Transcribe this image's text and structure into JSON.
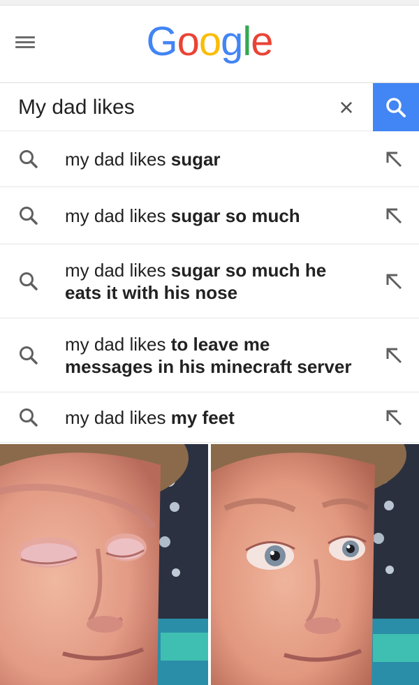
{
  "header": {
    "menu_icon": "hamburger-menu-icon",
    "logo_text": "Google",
    "logo_letters": [
      {
        "char": "G",
        "color": "#4285f4"
      },
      {
        "char": "o",
        "color": "#ea4335"
      },
      {
        "char": "o",
        "color": "#fbbc05"
      },
      {
        "char": "g",
        "color": "#4285f4"
      },
      {
        "char": "l",
        "color": "#34a853"
      },
      {
        "char": "e",
        "color": "#ea4335"
      }
    ]
  },
  "search": {
    "value": "My dad likes",
    "clear_icon": "close-icon",
    "clear_glyph": "×",
    "submit_icon": "search-icon",
    "accent_color": "#4285f4"
  },
  "suggestions": [
    {
      "prefix": "my dad likes ",
      "bold_lines": [
        "sugar"
      ],
      "icon": "search-icon",
      "fill_icon": "arrow-up-left-icon"
    },
    {
      "prefix": "my dad likes ",
      "bold_lines": [
        "sugar so much"
      ],
      "icon": "search-icon",
      "fill_icon": "arrow-up-left-icon"
    },
    {
      "prefix": "my dad likes ",
      "bold_lines": [
        "sugar so much he",
        "eats it with his nose"
      ],
      "icon": "search-icon",
      "fill_icon": "arrow-up-left-icon"
    },
    {
      "prefix": "my dad likes ",
      "bold_lines": [
        "to leave me",
        "messages in his minecraft server"
      ],
      "icon": "search-icon",
      "fill_icon": "arrow-up-left-icon"
    },
    {
      "prefix": "my dad likes ",
      "bold_lines": [
        "my feet"
      ],
      "icon": "search-icon",
      "fill_icon": "arrow-up-left-icon"
    }
  ],
  "meme": {
    "left_panel": "man-eyes-closed-image",
    "right_panel": "man-eyes-open-image"
  }
}
